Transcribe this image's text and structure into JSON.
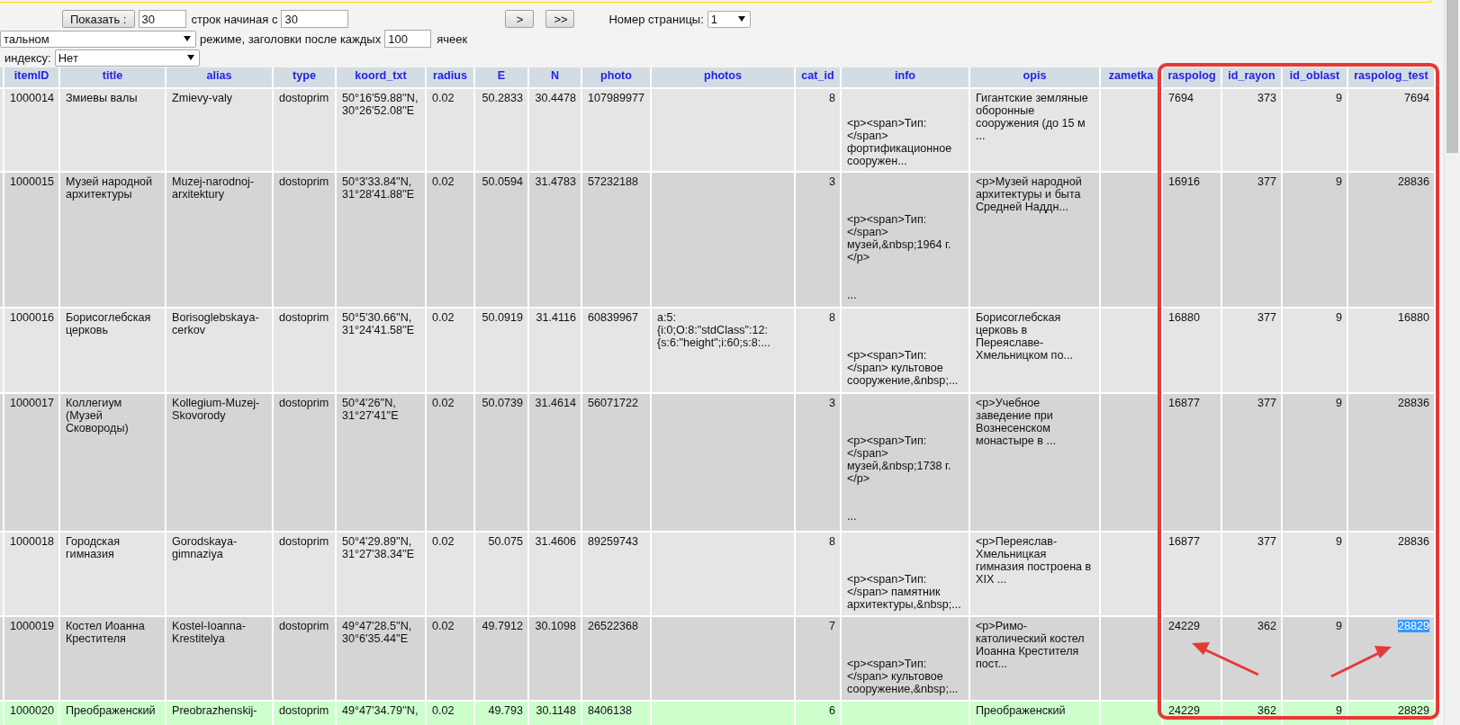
{
  "pager": {
    "show_button": "Показать :",
    "rows_count": "30",
    "rows_label": "строк начиная с",
    "start_row": "30",
    "next_button": ">",
    "last_button": ">>",
    "page_label": "Номер страницы:",
    "page_select": "1"
  },
  "display": {
    "mode_select": "тальном",
    "mode_label": "режиме, заголовки после каждых",
    "repeat_cells": "100",
    "cells_label": "ячеек"
  },
  "sort": {
    "label": "индексу:",
    "index_select": "Нет"
  },
  "table": {
    "columns": [
      "itemID",
      "title",
      "alias",
      "type",
      "koord_txt",
      "radius",
      "E",
      "N",
      "photo",
      "photos",
      "cat_id",
      "info",
      "opis",
      "zametka",
      "raspolog",
      "id_rayon",
      "id_oblast",
      "raspolog_test"
    ],
    "rows": [
      {
        "marked": false,
        "last_cell_selected": false,
        "cells": [
          "1000014",
          "Змиевы валы",
          "Zmievy-valy",
          "dostoprim",
          "50°16'59.88''N,\n30°26'52.08''E",
          "0.02",
          "50.2833",
          "30.4478",
          "107989977",
          "",
          "8",
          "\n\n<p><span>Тип:\n</span>\nфортификационное\nсооружен...",
          "Гигантские земляные\nоборонные\nсооружения (до 15 м\n...",
          "",
          "7694",
          "373",
          "9",
          "7694"
        ]
      },
      {
        "marked": false,
        "last_cell_selected": false,
        "cells": [
          "1000015",
          "Музей народной\nархитектуры",
          "Muzej-narodnoj-\narxitektury",
          "dostoprim",
          "50°3'33.84''N,\n31°28'41.88''E",
          "0.02",
          "50.0594",
          "31.4783",
          "57232188",
          "",
          "3",
          "\n\n\n<p><span>Тип:\n</span>\nмузей,&nbsp;1964 г.\n</p>\n\n\n...",
          "<p>Музей народной\nархитектуры и быта\nСредней Наддн...",
          "",
          "16916",
          "377",
          "9",
          "28836"
        ]
      },
      {
        "marked": false,
        "last_cell_selected": false,
        "cells": [
          "1000016",
          "Борисоглебская\nцерковь",
          "Borisoglebskaya-\ncerkov",
          "dostoprim",
          "50°5'30.66''N,\n31°24'41.58''E",
          "0.02",
          "50.0919",
          "31.4116",
          "60839967",
          "a:5:\n{i:0;O:8:\"stdClass\":12:\n{s:6:\"height\";i:60;s:8:...",
          "8",
          "\n\n\n<p><span>Тип:\n</span> культовое\nсооружение,&nbsp;...",
          "Борисоглебская\nцерковь в\nПереяславе-\nХмельницком по...",
          "",
          "16880",
          "377",
          "9",
          "16880"
        ]
      },
      {
        "marked": false,
        "last_cell_selected": false,
        "cells": [
          "1000017",
          "Коллегиум\n(Музей\nСковороды)",
          "Kollegium-Muzej-\nSkovorody",
          "dostoprim",
          "50°4'26''N,\n31°27'41''E",
          "0.02",
          "50.0739",
          "31.4614",
          "56071722",
          "",
          "3",
          "\n\n\n<p><span>Тип:\n</span>\nмузей,&nbsp;1738 г.\n</p>\n\n\n...",
          "<p>Учебное\nзаведение при\nВознесенском\nмонастыре в ...",
          "",
          "16877",
          "377",
          "9",
          "28836"
        ]
      },
      {
        "marked": false,
        "last_cell_selected": false,
        "cells": [
          "1000018",
          "Городская\nгимназия",
          "Gorodskaya-\ngimnaziya",
          "dostoprim",
          "50°4'29.89''N,\n31°27'38.34''E",
          "0.02",
          "50.075",
          "31.4606",
          "89259743",
          "",
          "8",
          "\n\n\n<p><span>Тип:\n</span> памятник\nархитектуры,&nbsp;...",
          "<p>Переяслав-\nХмельницкая\nгимназия построена в\nXIX ...",
          "",
          "16877",
          "377",
          "9",
          "28836"
        ]
      },
      {
        "marked": false,
        "last_cell_selected": true,
        "cells": [
          "1000019",
          "Костел Иоанна\nКрестителя",
          "Kostel-Ioanna-\nKrestitelya",
          "dostoprim",
          "49°47'28.5''N,\n30°6'35.44''E",
          "0.02",
          "49.7912",
          "30.1098",
          "26522368",
          "",
          "7",
          "\n\n\n<p><span>Тип:\n</span> культовое\nсооружение,&nbsp;...",
          "<p>Римо-\nкатолический костел\nИоанна Крестителя\nпост...",
          "",
          "24229",
          "362",
          "9",
          "28829"
        ]
      },
      {
        "marked": true,
        "last_cell_selected": false,
        "cells": [
          "1000020",
          "Преображенский",
          "Preobrazhenskij-",
          "dostoprim",
          "49°47'34.79''N,",
          "0.02",
          "49.793",
          "30.1148",
          "8406138",
          "",
          "6",
          "",
          "Преображенский",
          "",
          "24229",
          "362",
          "9",
          "28829"
        ]
      }
    ]
  }
}
